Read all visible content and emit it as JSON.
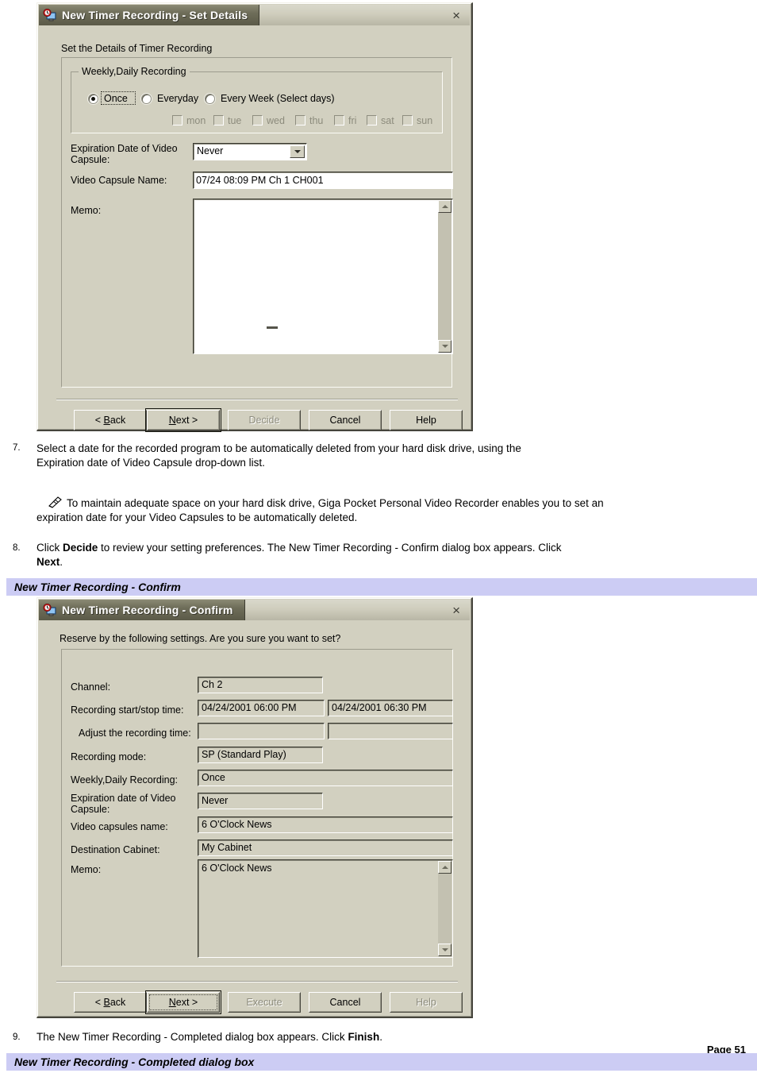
{
  "dialog1": {
    "title": "New Timer Recording - Set Details",
    "icon": "timer-recording-icon",
    "close_label": "×",
    "section_caption": "Set the Details of Timer Recording",
    "group": {
      "legend": "Weekly,Daily Recording",
      "radios": [
        {
          "label": "Once",
          "selected": true,
          "focused": true
        },
        {
          "label": "Everyday",
          "selected": false,
          "focused": false
        },
        {
          "label": "Every Week (Select days)",
          "selected": false,
          "focused": false
        }
      ],
      "days": [
        {
          "label": "mon",
          "checked": false,
          "disabled": true
        },
        {
          "label": "tue",
          "checked": false,
          "disabled": true
        },
        {
          "label": "wed",
          "checked": false,
          "disabled": true
        },
        {
          "label": "thu",
          "checked": false,
          "disabled": true
        },
        {
          "label": "fri",
          "checked": false,
          "disabled": true
        },
        {
          "label": "sat",
          "checked": false,
          "disabled": true
        },
        {
          "label": "sun",
          "checked": false,
          "disabled": true
        }
      ]
    },
    "expiration_label_line1": "Expiration Date of Video",
    "expiration_label_line2": "Capsule:",
    "expiration_value": "Never",
    "capsule_name_label": "Video Capsule Name:",
    "capsule_name_value": "07/24 08:09 PM Ch 1 CH001",
    "memo_label": "Memo:",
    "memo_value": "",
    "buttons": [
      {
        "label": "< Back",
        "accel": "B",
        "state": "normal"
      },
      {
        "label": "Next >",
        "accel": "N",
        "state": "default"
      },
      {
        "label": "Decide",
        "accel": "",
        "state": "disabled"
      },
      {
        "label": "Cancel",
        "accel": "",
        "state": "normal"
      },
      {
        "label": "Help",
        "accel": "",
        "state": "normal"
      }
    ]
  },
  "dialog2": {
    "title": "New Timer Recording - Confirm",
    "icon": "timer-recording-icon",
    "close_label": "×",
    "section_caption": "Reserve by the following settings. Are you sure you want to set?",
    "rows": [
      {
        "label": "Channel:",
        "value": "Ch 2"
      },
      {
        "label": "Recording start/stop time:",
        "value": "04/24/2001 06:00 PM",
        "value2": "04/24/2001 06:30 PM"
      },
      {
        "label": "Adjust the recording time:",
        "value": "",
        "value2": ""
      },
      {
        "label": "Recording mode:",
        "value": "SP (Standard Play)"
      },
      {
        "label": "Weekly,Daily Recording:",
        "value": "Once"
      },
      {
        "label": "Expiration date of Video",
        "label2": "Capsule:",
        "value": "Never"
      },
      {
        "label": "Video capsules name:",
        "value": "6 O'Clock News"
      },
      {
        "label": "Destination Cabinet:",
        "value": "My Cabinet"
      },
      {
        "label": "Memo:",
        "value": "6 O'Clock News"
      }
    ],
    "buttons": [
      {
        "label": "< Back",
        "accel": "B",
        "state": "normal"
      },
      {
        "label": "Next >",
        "accel": "N",
        "state": "default"
      },
      {
        "label": "Execute",
        "accel": "",
        "state": "disabled"
      },
      {
        "label": "Cancel",
        "accel": "",
        "state": "normal"
      },
      {
        "label": "Help",
        "accel": "",
        "state": "disabled"
      }
    ]
  },
  "document": {
    "step7_num": "7.",
    "step7_line1": "Select a date for the recorded program to be automatically deleted from your hard disk drive, using the",
    "step7_line2": "Expiration date of Video Capsule drop-down list.",
    "note_line1": "To maintain adequate space on your hard disk drive, Giga Pocket Personal Video Recorder enables you to set an",
    "note_line2": "expiration date for your Video Capsules to be automatically deleted.",
    "step8_num": "8.",
    "step8_a": "Click ",
    "step8_b": "Decide",
    "step8_c": " to review your setting preferences. The New Timer Recording - Confirm dialog box appears. Click",
    "step8_d": "Next",
    "step8_e": ".",
    "band1": "New Timer Recording - Confirm",
    "step9_num": "9.",
    "step9_a": "The New Timer Recording - Completed dialog box appears. Click ",
    "step9_b": "Finish",
    "step9_c": ".",
    "page_number": "Page 51",
    "band2": "New Timer Recording - Completed dialog box"
  },
  "colors": {
    "dialog_face": "#d2d0c0",
    "titlebar_active": "#6e6d59",
    "band_purple": "#ccccf4",
    "field_white": "#ffffff",
    "disabled_text": "#8c8b7c"
  }
}
